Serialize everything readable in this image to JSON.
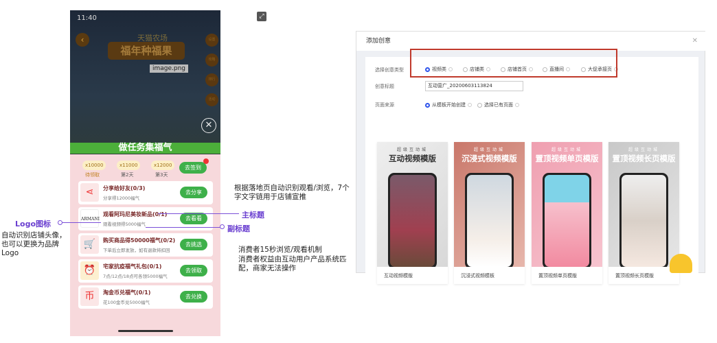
{
  "phone": {
    "time": "11:40",
    "farm_title": "天猫农场",
    "main_title": "福年种福果",
    "image_tip": "image.png",
    "banner": "做任务集福气",
    "side_buttons": [
      "设置",
      "攻略",
      "排行",
      "活动"
    ],
    "checkin": {
      "coins": [
        "x10000",
        "x11000",
        "x12000"
      ],
      "labels": [
        "待领取",
        "第2天",
        "第3天"
      ],
      "button": "去签到"
    },
    "tasks": [
      {
        "icon": "share-icon",
        "title": "分享给好友(0/3)",
        "sub": "分享得12000福气",
        "button": "去分享"
      },
      {
        "icon": "armani-logo",
        "logo_text": "ARMANI",
        "title": "观看阿玛尼美妆新品(0/1)",
        "sub": "观看视频得5000福气",
        "button": "去看看"
      },
      {
        "icon": "cart-icon",
        "title": "购买商品得50000福气(0/2)",
        "sub": "下单后立即发放，如有退款将扣回",
        "button": "去挑选"
      },
      {
        "icon": "alarm-icon",
        "title": "宅家抗疫福气礼包(0/1)",
        "sub": "7点/12点/18点可各领5000福气",
        "button": "去领取"
      },
      {
        "icon": "coin-icon",
        "title": "淘金币兑福气(0/1)",
        "sub": "花100金币兑5000福气",
        "button": "去兑换"
      }
    ]
  },
  "annotations": {
    "logo_title": "Logo图标",
    "logo_desc": "自动识别店铺头像，也可以更换为品牌Logo",
    "auto_desc": "根据落地页自动识别观看/浏览，7个字文字链用于店铺宣推",
    "main_title": "主标题",
    "sub_title": "副标题",
    "mechanism_1": "消费者15秒浏览/观看机制",
    "mechanism_2": "消费者权益由互动用户产品系统匹配，商家无法操作"
  },
  "dialog": {
    "title": "添加创意",
    "type_label": "选择创意类型",
    "types": [
      "视频类",
      "店铺类",
      "店铺首页",
      "直播间",
      "大促承接页"
    ],
    "selected_type": "视频类",
    "title_label": "创意标题",
    "title_value": "互动营广_20200603113824",
    "source_label": "页面来源",
    "sources": [
      "从模板开始创建",
      "选择已有页面"
    ],
    "selected_source": "从模板开始创建",
    "templates": [
      {
        "tag": "超级互动城",
        "heading": "互动视频模版",
        "name": "互动视频模版"
      },
      {
        "tag": "超级互动城",
        "heading": "沉浸式视频模版",
        "name": "沉浸式视频模板"
      },
      {
        "tag": "超级互动城",
        "heading": "置顶视频单页模版",
        "name": "置顶视频单页模版"
      },
      {
        "tag": "超级互动城",
        "heading": "置顶视频长页模版",
        "name": "置顶视频长页模版"
      }
    ]
  },
  "colors": {
    "accent_green": "#3eb04a",
    "annotation_purple": "#7a4fd8",
    "highlight_red": "#c0392b",
    "radio_blue": "#2f54eb"
  }
}
